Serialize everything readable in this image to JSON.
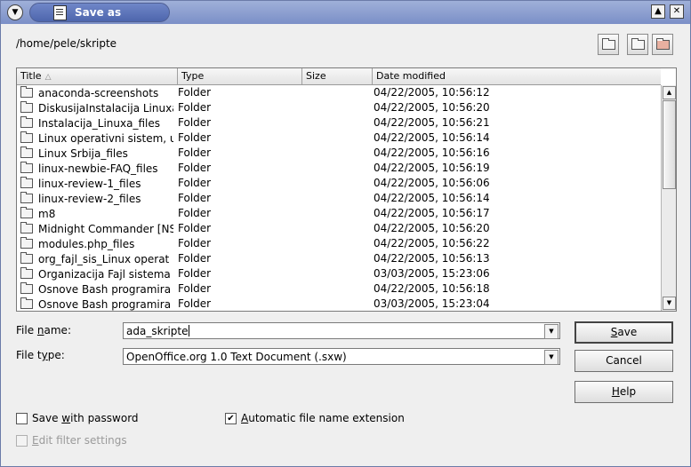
{
  "window": {
    "title": "Save as",
    "menu_icon": "chevron-down-icon",
    "maximize_icon": "triangle-up-icon",
    "close_icon": "close-icon"
  },
  "toolbar": {
    "path": "/home/pele/skripte",
    "buttons": [
      "up-one-level-icon",
      "create-new-folder-icon",
      "default-directory-icon"
    ]
  },
  "file_list": {
    "columns": [
      "Title",
      "Type",
      "Size",
      "Date modified"
    ],
    "rows": [
      {
        "title": "anaconda-screenshots",
        "type": "Folder",
        "size": "",
        "date": "04/22/2005, 10:56:12"
      },
      {
        "title": "DiskusijaInstalacija Linuxa",
        "type": "Folder",
        "size": "",
        "date": "04/22/2005, 10:56:20"
      },
      {
        "title": "Instalacija_Linuxa_files",
        "type": "Folder",
        "size": "",
        "date": "04/22/2005, 10:56:21"
      },
      {
        "title": "Linux operativni sistem, u",
        "type": "Folder",
        "size": "",
        "date": "04/22/2005, 10:56:14"
      },
      {
        "title": "Linux Srbija_files",
        "type": "Folder",
        "size": "",
        "date": "04/22/2005, 10:56:16"
      },
      {
        "title": "linux-newbie-FAQ_files",
        "type": "Folder",
        "size": "",
        "date": "04/22/2005, 10:56:19"
      },
      {
        "title": "linux-review-1_files",
        "type": "Folder",
        "size": "",
        "date": "04/22/2005, 10:56:06"
      },
      {
        "title": "linux-review-2_files",
        "type": "Folder",
        "size": "",
        "date": "04/22/2005, 10:56:14"
      },
      {
        "title": "m8",
        "type": "Folder",
        "size": "",
        "date": "04/22/2005, 10:56:17"
      },
      {
        "title": "Midnight Commander [NS",
        "type": "Folder",
        "size": "",
        "date": "04/22/2005, 10:56:20"
      },
      {
        "title": "modules.php_files",
        "type": "Folder",
        "size": "",
        "date": "04/22/2005, 10:56:22"
      },
      {
        "title": "org_fajl_sis_Linux operat",
        "type": "Folder",
        "size": "",
        "date": "04/22/2005, 10:56:13"
      },
      {
        "title": "Organizacija Fajl sistema",
        "type": "Folder",
        "size": "",
        "date": "03/03/2005, 15:23:06"
      },
      {
        "title": "Osnove Bash programira",
        "type": "Folder",
        "size": "",
        "date": "04/22/2005, 10:56:18"
      },
      {
        "title": "Osnove Bash programira",
        "type": "Folder",
        "size": "",
        "date": "03/03/2005, 15:23:04"
      }
    ]
  },
  "form": {
    "file_name_label_pre": "File ",
    "file_name_label_u": "n",
    "file_name_label_post": "ame:",
    "file_name_value": "ada_skripte",
    "file_type_label_pre": "File t",
    "file_type_label_u": "y",
    "file_type_label_post": "pe:",
    "file_type_value": "OpenOffice.org 1.0 Text Document (.sxw)"
  },
  "buttons": {
    "save_u": "S",
    "save_rest": "ave",
    "cancel": "Cancel",
    "help_u": "H",
    "help_rest": "elp"
  },
  "options": {
    "save_with_password_pre": "Save ",
    "save_with_password_u": "w",
    "save_with_password_post": "ith password",
    "save_with_password_checked": false,
    "auto_ext_u": "A",
    "auto_ext_rest": "utomatic file name extension",
    "auto_ext_checked": true,
    "edit_filter_u": "E",
    "edit_filter_rest": "dit filter settings",
    "edit_filter_enabled": false
  }
}
